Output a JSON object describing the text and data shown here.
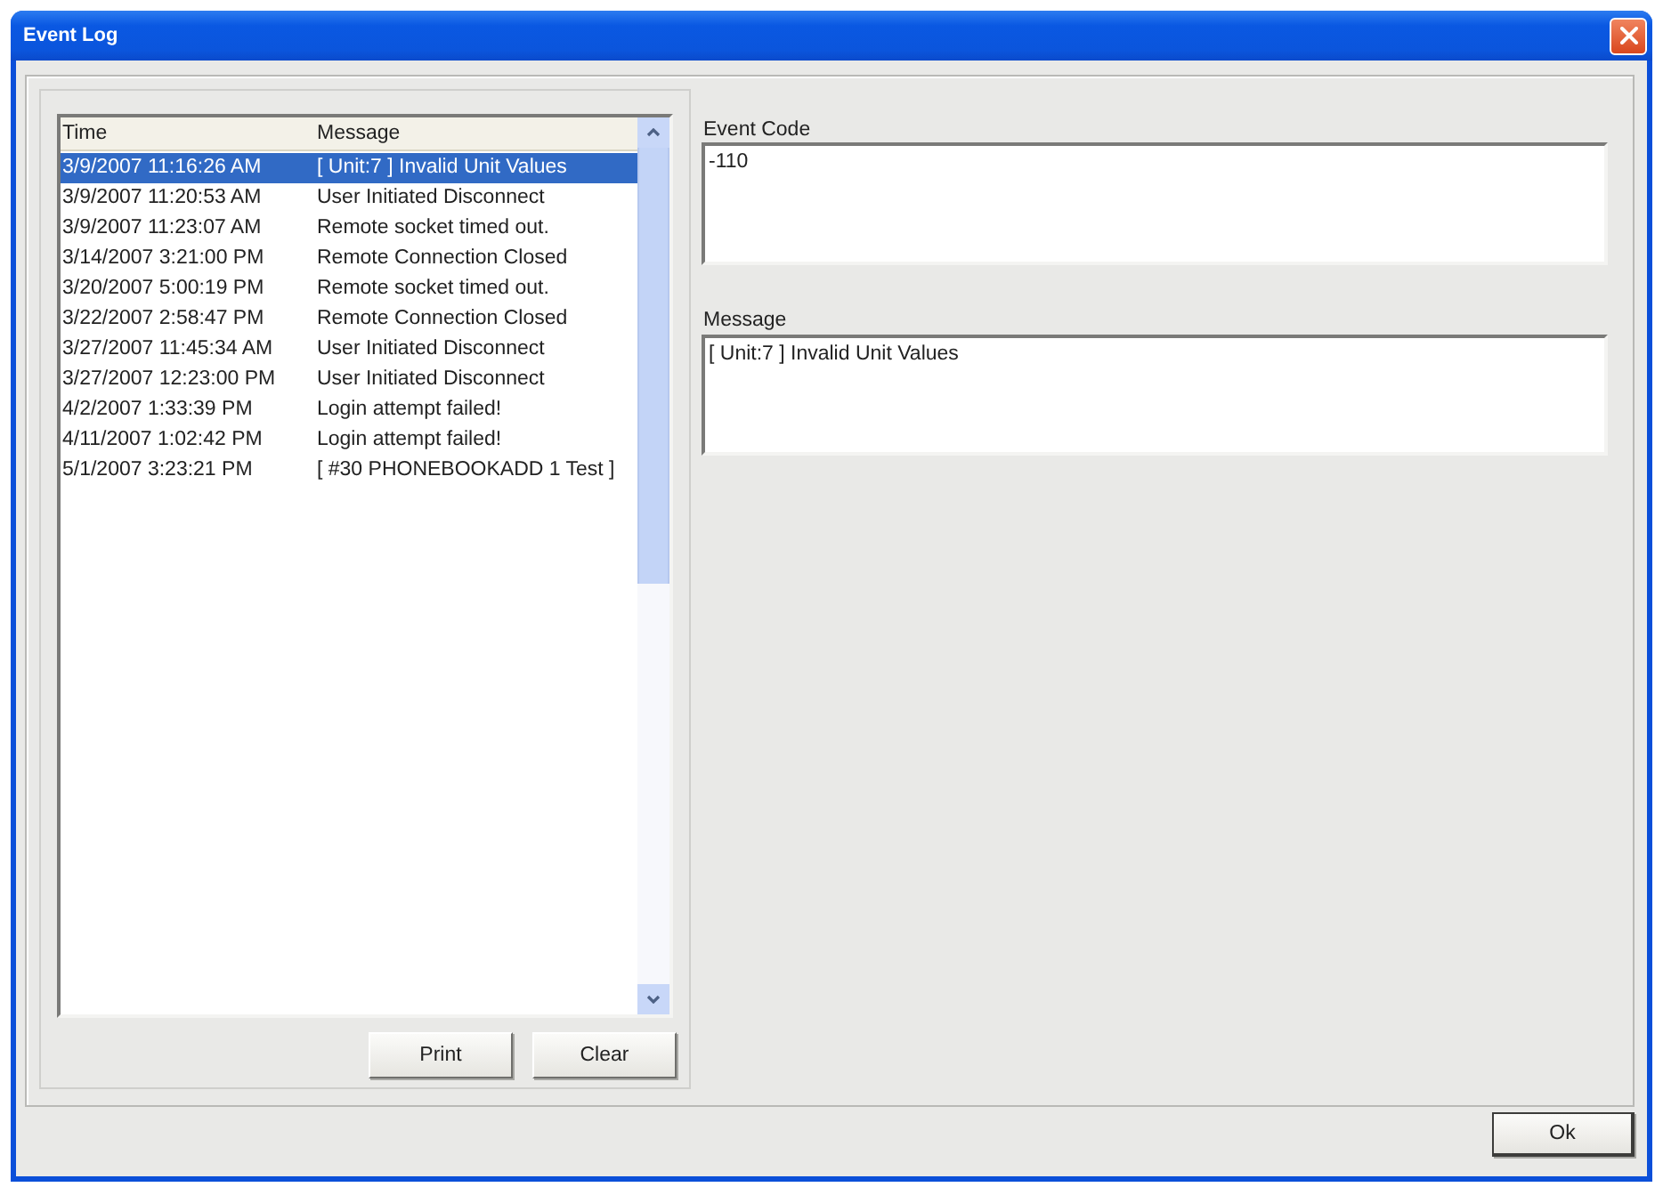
{
  "window": {
    "title": "Event Log"
  },
  "event_list": {
    "columns": [
      "Time",
      "Message"
    ],
    "rows": [
      {
        "time": "3/9/2007 11:16:26 AM",
        "message": "[ Unit:7 ] Invalid Unit Values",
        "selected": true
      },
      {
        "time": "3/9/2007 11:20:53 AM",
        "message": "User Initiated Disconnect",
        "selected": false
      },
      {
        "time": "3/9/2007 11:23:07 AM",
        "message": "Remote socket timed out.",
        "selected": false
      },
      {
        "time": "3/14/2007 3:21:00 PM",
        "message": "Remote Connection Closed",
        "selected": false
      },
      {
        "time": "3/20/2007 5:00:19 PM",
        "message": "Remote socket timed out.",
        "selected": false
      },
      {
        "time": "3/22/2007 2:58:47 PM",
        "message": "Remote Connection Closed",
        "selected": false
      },
      {
        "time": "3/27/2007 11:45:34 AM",
        "message": "User Initiated Disconnect",
        "selected": false
      },
      {
        "time": "3/27/2007 12:23:00 PM",
        "message": "User Initiated Disconnect",
        "selected": false
      },
      {
        "time": "4/2/2007 1:33:39 PM",
        "message": "Login attempt failed!",
        "selected": false
      },
      {
        "time": "4/11/2007 1:02:42 PM",
        "message": "Login attempt failed!",
        "selected": false
      },
      {
        "time": "5/1/2007 3:23:21 PM",
        "message": "[ #30 PHONEBOOKADD 1 Test ]",
        "selected": false
      }
    ]
  },
  "list_buttons": [
    "Print",
    "Clear"
  ],
  "event_code": {
    "label": "Event Code",
    "value": "-110"
  },
  "message": {
    "label": "Message",
    "value": "[ Unit:7 ] Invalid Unit Values"
  },
  "buttons": [
    "Ok"
  ]
}
